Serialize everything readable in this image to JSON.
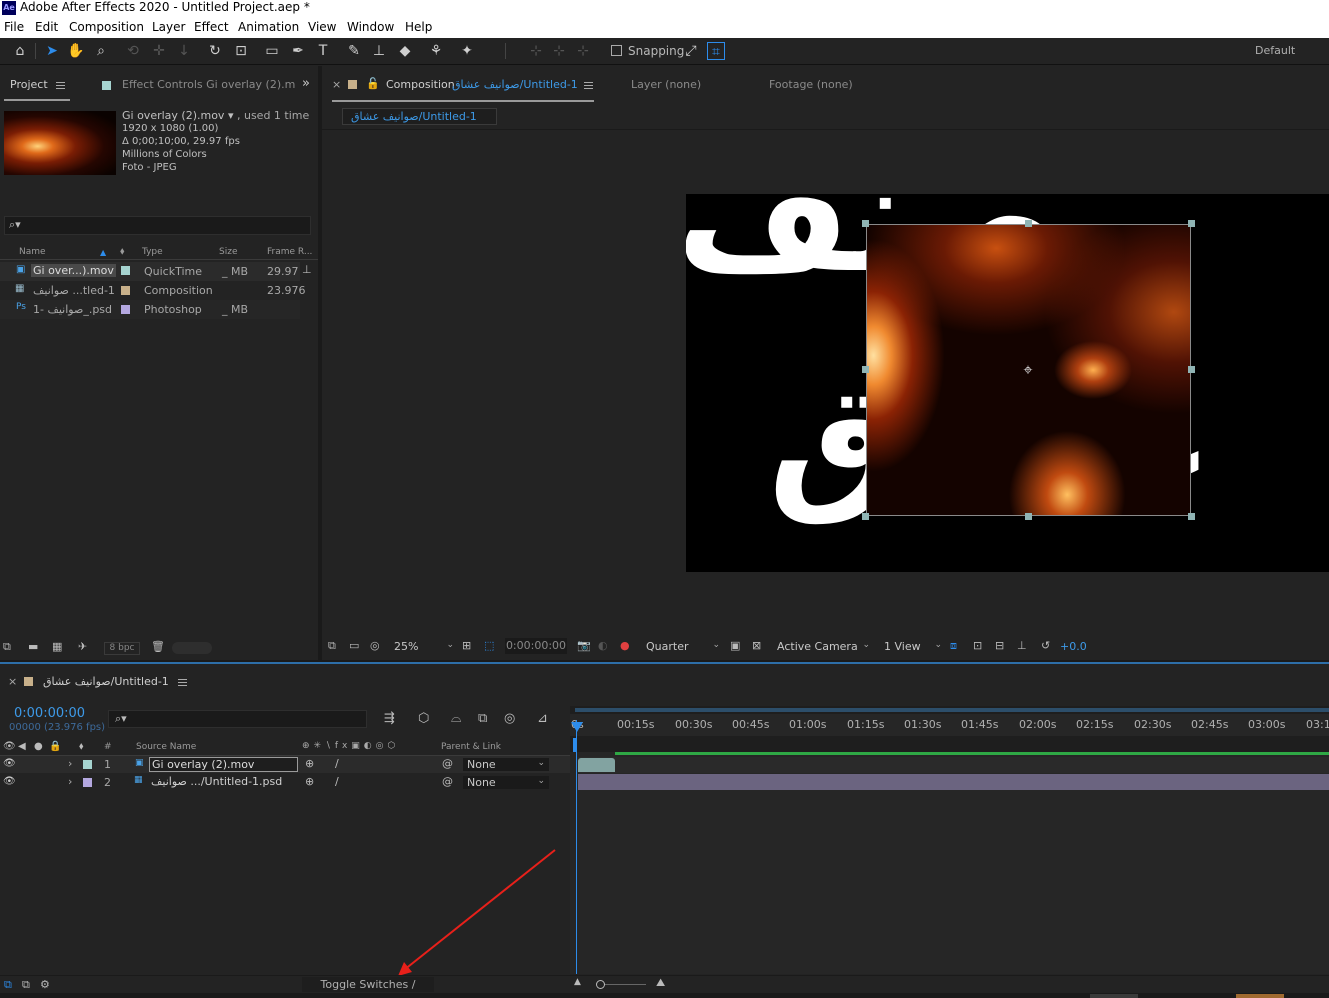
{
  "app": {
    "title": "Adobe After Effects 2020 - Untitled Project.aep *",
    "logo": "Ae"
  },
  "menu": [
    "File",
    "Edit",
    "Composition",
    "Layer",
    "Effect",
    "Animation",
    "View",
    "Window",
    "Help"
  ],
  "toolbar": {
    "snapping_label": "Snapping",
    "workspace": "Default"
  },
  "project_panel": {
    "tab_project": "Project",
    "tab_effect_controls": "Effect Controls Gi overlay (2).m",
    "selected_item": {
      "name": "Gi overlay (2).mov",
      "used": ", used 1 time",
      "dims": "1920 x 1080 (1.00)",
      "duration": "Δ 0;00;10;00, 29.97 fps",
      "colors": "Millions of Colors",
      "codec": "Foto - JPEG"
    },
    "search_placeholder": "",
    "columns": {
      "name": "Name",
      "type": "Type",
      "size": "Size",
      "frame_rate": "Frame R..."
    },
    "items": [
      {
        "name": "Gi over...).mov",
        "type": "QuickTime",
        "size": "_ MB",
        "fps": "29.97",
        "label_color": "#a6d4d0",
        "icon": "footage-icon"
      },
      {
        "name": "صوانيف ...tled-1",
        "type": "Composition",
        "size": "",
        "fps": "23.976",
        "label_color": "#c8b08a",
        "icon": "composition-icon"
      },
      {
        "name": "1- صوانيف_.psd",
        "type": "Photoshop",
        "size": "_ MB",
        "fps": "",
        "label_color": "#b4a8e0",
        "icon": "photoshop-icon"
      }
    ],
    "bpc": "8 bpc"
  },
  "composition_panel": {
    "tab_label_prefix": "Composition",
    "tab_label_name": "صوانيف عشاق/Untitled-1",
    "tab_layer": "Layer (none)",
    "tab_footage": "Footage (none)",
    "breadcrumb": "صوانيف عشاق/Untitled-1",
    "viewer_text": {
      "line1": "صنف",
      "line2": "عشاق"
    },
    "bottom": {
      "zoom": "25%",
      "time": "0:00:00:00",
      "resolution": "Quarter",
      "camera": "Active Camera",
      "views": "1 View",
      "exposure": "+0.0"
    }
  },
  "timeline_panel": {
    "tab_label": "صوانيف عشاق/Untitled-1",
    "current_time": "0:00:00:00",
    "frame_info": "00000 (23.976 fps)",
    "search_placeholder": "",
    "columns": {
      "source_name": "Source Name",
      "parent_link": "Parent & Link"
    },
    "ruler": [
      "0s",
      "00:15s",
      "00:30s",
      "00:45s",
      "01:00s",
      "01:15s",
      "01:30s",
      "01:45s",
      "02:00s",
      "02:15s",
      "02:30s",
      "02:45s",
      "03:00s",
      "03:1"
    ],
    "layers": [
      {
        "num": "1",
        "name": "Gi overlay (2).mov",
        "parent": "None",
        "label_color": "#a6d4d0"
      },
      {
        "num": "2",
        "name": "صوانيف .../Untitled-1.psd",
        "parent": "None",
        "label_color": "#b4a8e0"
      }
    ],
    "toggle_label": "Toggle Switches / Modes"
  },
  "colors": {
    "accent": "#2d8ceb",
    "annotation_arrow": "#e8201a"
  }
}
